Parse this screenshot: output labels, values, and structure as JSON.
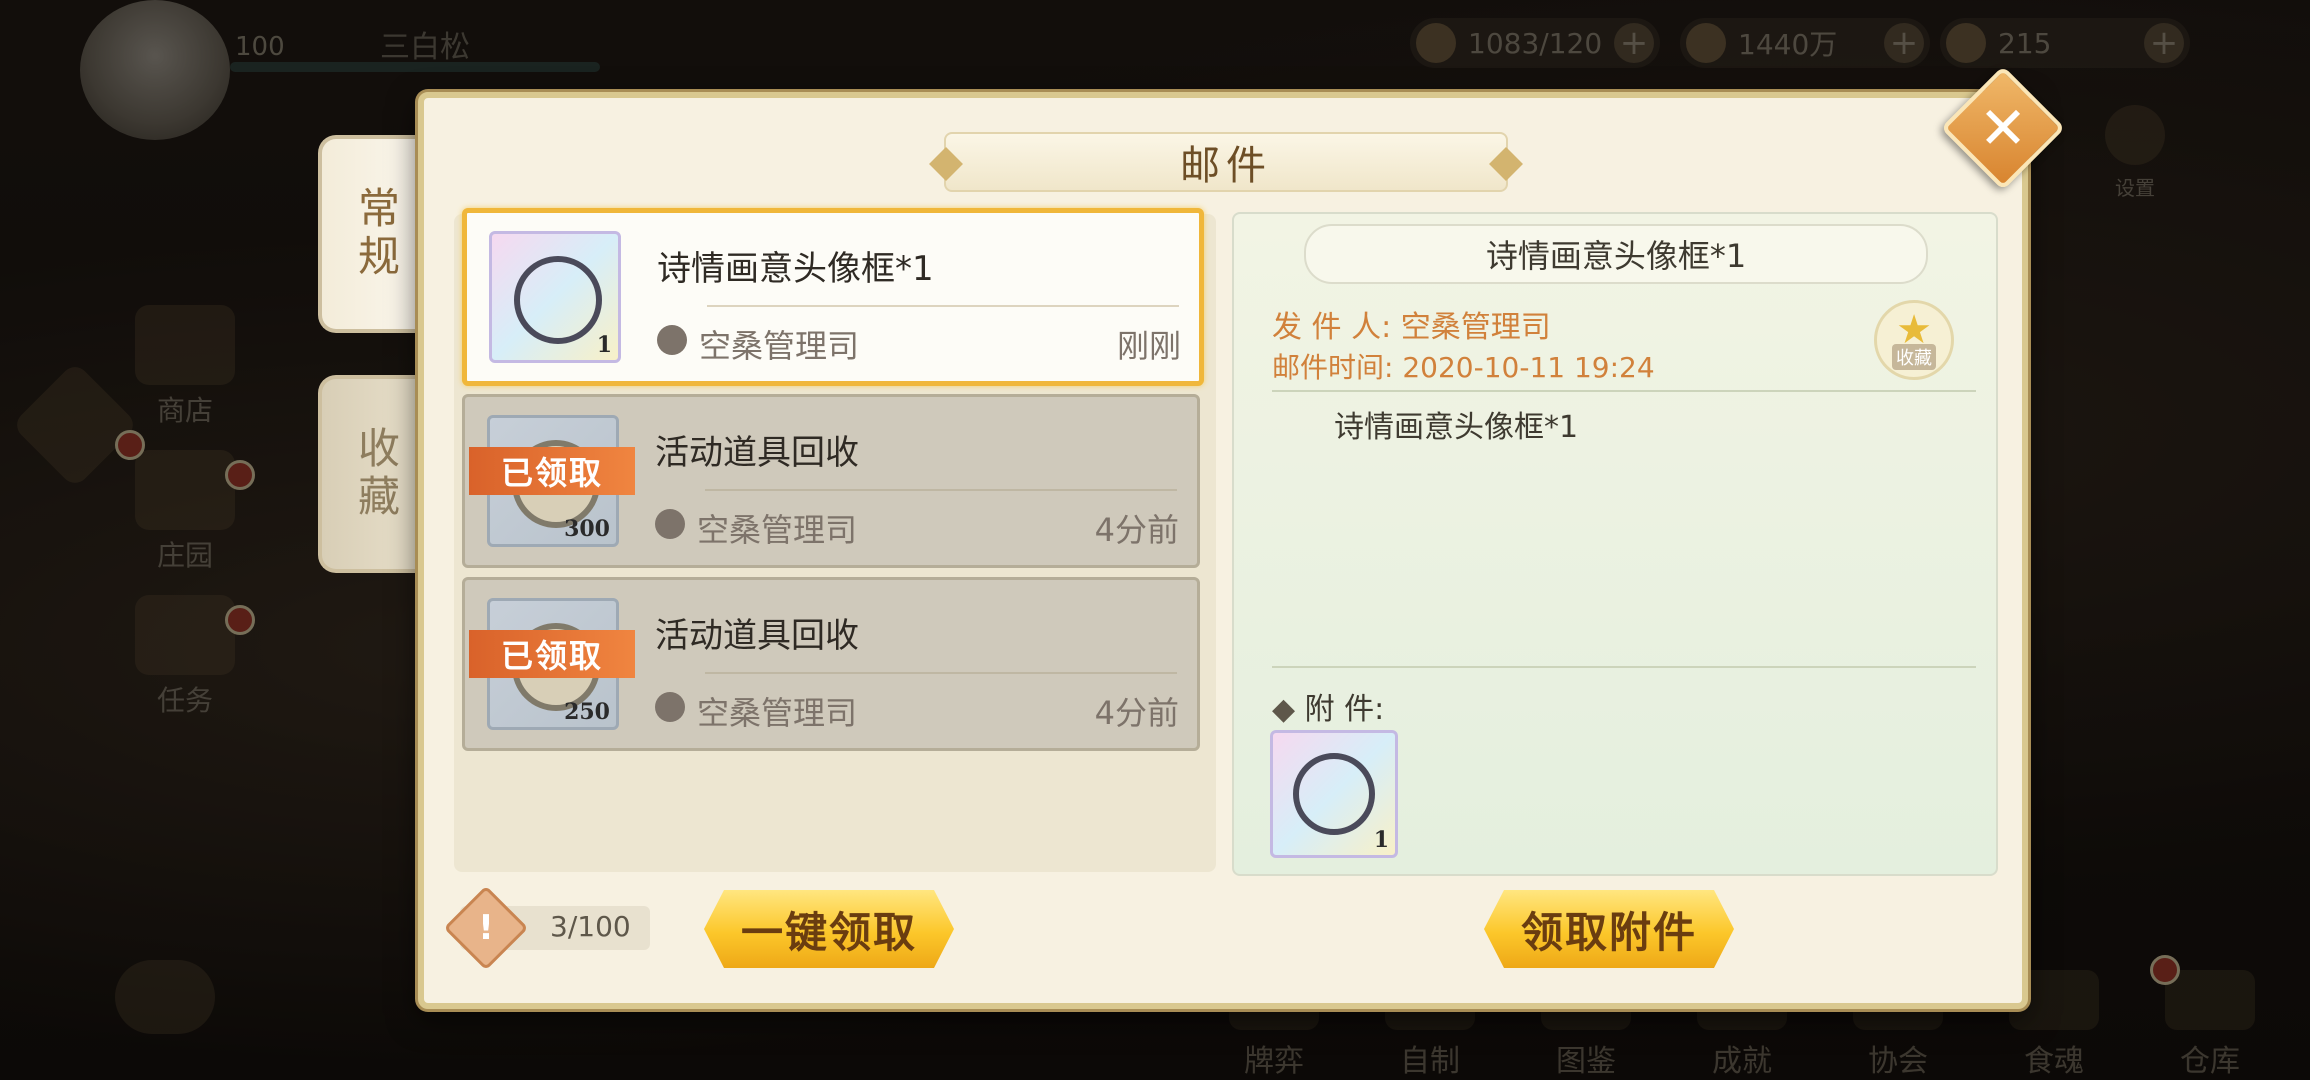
{
  "hud": {
    "level": "100",
    "player_name": "三白松",
    "stamina": "1083/120",
    "coins": "1440万",
    "gems": "215"
  },
  "side_menu": {
    "shop": "商店",
    "manor": "庄园",
    "tasks": "任务",
    "settings": "设置"
  },
  "bottom_nav": [
    "牌弈",
    "自制",
    "图鉴",
    "成就",
    "协会",
    "食魂",
    "仓库"
  ],
  "tabs": {
    "normal": "常规",
    "favorites": "收藏"
  },
  "panel": {
    "title": "邮件"
  },
  "mails": [
    {
      "title": "诗情画意头像框*1",
      "sender": "空桑管理司",
      "time": "刚刚",
      "qty": "1",
      "claimed": "",
      "state": "active"
    },
    {
      "title": "活动道具回收",
      "sender": "空桑管理司",
      "time": "4分前",
      "qty": "300",
      "claimed": "已领取",
      "state": "read"
    },
    {
      "title": "活动道具回收",
      "sender": "空桑管理司",
      "time": "4分前",
      "qty": "250",
      "claimed": "已领取",
      "state": "read"
    }
  ],
  "detail": {
    "title": "诗情画意头像框*1",
    "sender_label": "发 件 人:",
    "sender": "空桑管理司",
    "time_label": "邮件时间:",
    "time": "2020-10-11  19:24",
    "favorite_label": "收藏",
    "body": "诗情画意头像框*1",
    "attachment_label": "附      件:",
    "attachment_qty": "1"
  },
  "footer": {
    "mail_count": "3/100",
    "claim_all": "一键领取",
    "claim_attachment": "领取附件"
  },
  "colors": {
    "accent_gold": "#fcc72a",
    "active_border": "#f0b73a",
    "meta_orange": "#d1813b",
    "claimed_orange": "#e8722f"
  }
}
